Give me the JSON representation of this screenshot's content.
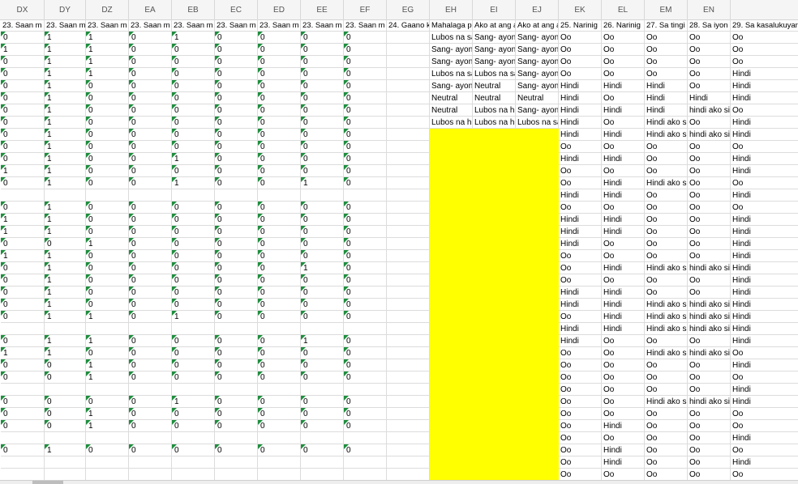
{
  "sheet": {
    "columns": [
      {
        "letter": "DX",
        "header": "23. Saan m"
      },
      {
        "letter": "DY",
        "header": "23. Saan m"
      },
      {
        "letter": "DZ",
        "header": "23. Saan m"
      },
      {
        "letter": "EA",
        "header": "23. Saan m"
      },
      {
        "letter": "EB",
        "header": "23. Saan m"
      },
      {
        "letter": "EC",
        "header": "23. Saan m"
      },
      {
        "letter": "ED",
        "header": "23. Saan m"
      },
      {
        "letter": "EE",
        "header": "23. Saan m"
      },
      {
        "letter": "EF",
        "header": "23. Saan m"
      },
      {
        "letter": "EG",
        "header": "24. Gaano k"
      },
      {
        "letter": "EH",
        "header": "Mahalaga p"
      },
      {
        "letter": "EI",
        "header": "Ako at ang a"
      },
      {
        "letter": "EJ",
        "header": "Ako at ang a"
      },
      {
        "letter": "EK",
        "header": "25. Narinig"
      },
      {
        "letter": "EL",
        "header": "26. Narinig"
      },
      {
        "letter": "EM",
        "header": "27. Sa tingi"
      },
      {
        "letter": "EN",
        "header": "28. Sa iyon"
      },
      {
        "letter": "",
        "header": "29. Sa kasalukuyan"
      }
    ],
    "rows": [
      [
        "0",
        "1",
        "1",
        "0",
        "1",
        "0",
        "0",
        "0",
        "0",
        "",
        "Lubos na sa",
        "Sang- ayon",
        "Sang- ayon",
        "Oo",
        "Oo",
        "Oo",
        "Oo",
        "Oo"
      ],
      [
        "1",
        "1",
        "1",
        "0",
        "0",
        "0",
        "0",
        "0",
        "0",
        "",
        "Sang- ayon",
        "Sang- ayon",
        "Sang- ayon",
        "Oo",
        "Oo",
        "Oo",
        "Oo",
        "Oo"
      ],
      [
        "0",
        "1",
        "1",
        "0",
        "0",
        "0",
        "0",
        "0",
        "0",
        "",
        "Sang- ayon",
        "Sang- ayon",
        "Sang- ayon",
        "Oo",
        "Oo",
        "Oo",
        "Oo",
        "Oo"
      ],
      [
        "0",
        "1",
        "1",
        "0",
        "0",
        "0",
        "0",
        "0",
        "0",
        "",
        "Lubos na sa",
        "Lubos na sa",
        "Sang- ayon",
        "Oo",
        "Oo",
        "Oo",
        "Oo",
        "Hindi"
      ],
      [
        "0",
        "1",
        "0",
        "0",
        "0",
        "0",
        "0",
        "0",
        "0",
        "",
        "Sang- ayon",
        "Neutral",
        "Sang- ayon",
        "Hindi",
        "Hindi",
        "Hindi",
        "Oo",
        "Hindi"
      ],
      [
        "0",
        "1",
        "0",
        "0",
        "0",
        "0",
        "0",
        "0",
        "0",
        "",
        "Neutral",
        "Neutral",
        "Neutral",
        "Hindi",
        "Oo",
        "Hindi",
        "Hindi",
        "Hindi"
      ],
      [
        "0",
        "1",
        "0",
        "0",
        "0",
        "0",
        "0",
        "0",
        "0",
        "",
        "Neutral",
        "Lubos na hi",
        "Sang- ayon",
        "Hindi",
        "Hindi",
        "Hindi",
        "hindi ako si",
        "Oo"
      ],
      [
        "0",
        "1",
        "0",
        "0",
        "0",
        "0",
        "0",
        "0",
        "0",
        "",
        "Lubos na hi",
        "Lubos na hi",
        "Lubos na sa",
        "Hindi",
        "Oo",
        "Hindi ako s",
        "Oo",
        "Hindi"
      ],
      [
        "0",
        "1",
        "0",
        "0",
        "0",
        "0",
        "0",
        "0",
        "0",
        "",
        "",
        "",
        "",
        "Hindi",
        "Hindi",
        "Hindi ako s",
        "hindi ako si",
        "Hindi"
      ],
      [
        "0",
        "1",
        "0",
        "0",
        "0",
        "0",
        "0",
        "0",
        "0",
        "",
        "",
        "",
        "",
        "Oo",
        "Oo",
        "Oo",
        "Oo",
        "Oo"
      ],
      [
        "0",
        "1",
        "0",
        "0",
        "1",
        "0",
        "0",
        "0",
        "0",
        "",
        "",
        "",
        "",
        "Hindi",
        "Hindi",
        "Oo",
        "Oo",
        "Hindi"
      ],
      [
        "1",
        "1",
        "0",
        "0",
        "0",
        "0",
        "0",
        "0",
        "0",
        "",
        "",
        "",
        "",
        "Oo",
        "Oo",
        "Oo",
        "Oo",
        "Hindi"
      ],
      [
        "0",
        "1",
        "0",
        "0",
        "1",
        "0",
        "0",
        "1",
        "0",
        "",
        "",
        "",
        "",
        "Oo",
        "Hindi",
        "Hindi ako s",
        "Oo",
        "Oo"
      ],
      [
        "",
        "",
        "",
        "",
        "",
        "",
        "",
        "",
        "",
        "",
        "",
        "",
        "",
        "Hindi",
        "Hindi",
        "Oo",
        "Oo",
        "Hindi"
      ],
      [
        "0",
        "1",
        "0",
        "0",
        "0",
        "0",
        "0",
        "0",
        "0",
        "",
        "",
        "",
        "",
        "Oo",
        "Oo",
        "Oo",
        "Oo",
        "Oo"
      ],
      [
        "1",
        "1",
        "0",
        "0",
        "0",
        "0",
        "0",
        "0",
        "0",
        "",
        "",
        "",
        "",
        "Hindi",
        "Hindi",
        "Oo",
        "Oo",
        "Hindi"
      ],
      [
        "1",
        "1",
        "0",
        "0",
        "0",
        "0",
        "0",
        "0",
        "0",
        "",
        "",
        "",
        "",
        "Hindi",
        "Hindi",
        "Oo",
        "Oo",
        "Hindi"
      ],
      [
        "0",
        "0",
        "1",
        "0",
        "0",
        "0",
        "0",
        "0",
        "0",
        "",
        "",
        "",
        "",
        "Hindi",
        "Oo",
        "Oo",
        "Oo",
        "Hindi"
      ],
      [
        "1",
        "1",
        "0",
        "0",
        "0",
        "0",
        "0",
        "0",
        "0",
        "",
        "",
        "",
        "",
        "Oo",
        "Oo",
        "Oo",
        "Oo",
        "Hindi"
      ],
      [
        "0",
        "1",
        "0",
        "0",
        "0",
        "0",
        "0",
        "1",
        "0",
        "",
        "",
        "",
        "",
        "Oo",
        "Hindi",
        "Hindi ako s",
        "hindi ako si",
        "Hindi"
      ],
      [
        "0",
        "1",
        "0",
        "0",
        "0",
        "0",
        "0",
        "0",
        "0",
        "",
        "",
        "",
        "",
        "Oo",
        "Oo",
        "Oo",
        "Oo",
        "Hindi"
      ],
      [
        "0",
        "1",
        "0",
        "0",
        "0",
        "0",
        "0",
        "0",
        "0",
        "",
        "",
        "",
        "",
        "Hindi",
        "Hindi",
        "Oo",
        "Oo",
        "Hindi"
      ],
      [
        "0",
        "1",
        "0",
        "0",
        "0",
        "0",
        "0",
        "0",
        "0",
        "",
        "",
        "",
        "",
        "Hindi",
        "Hindi",
        "Hindi ako s",
        "hindi ako si",
        "Hindi"
      ],
      [
        "0",
        "1",
        "1",
        "0",
        "1",
        "0",
        "0",
        "0",
        "0",
        "",
        "",
        "",
        "",
        "Oo",
        "Hindi",
        "Hindi ako s",
        "hindi ako si",
        "Hindi"
      ],
      [
        "",
        "",
        "",
        "",
        "",
        "",
        "",
        "",
        "",
        "",
        "",
        "",
        "",
        "Hindi",
        "Hindi",
        "Hindi ako s",
        "hindi ako si",
        "Hindi"
      ],
      [
        "0",
        "1",
        "1",
        "0",
        "0",
        "0",
        "0",
        "1",
        "0",
        "",
        "",
        "",
        "",
        "Hindi",
        "Oo",
        "Oo",
        "Oo",
        "Hindi"
      ],
      [
        "1",
        "1",
        "0",
        "0",
        "0",
        "0",
        "0",
        "0",
        "0",
        "",
        "",
        "",
        "",
        "Oo",
        "Oo",
        "Hindi ako s",
        "hindi ako si",
        "Oo"
      ],
      [
        "0",
        "0",
        "1",
        "0",
        "0",
        "0",
        "0",
        "0",
        "0",
        "",
        "",
        "",
        "",
        "Oo",
        "Oo",
        "Oo",
        "Oo",
        "Hindi"
      ],
      [
        "0",
        "0",
        "1",
        "0",
        "0",
        "0",
        "0",
        "0",
        "0",
        "",
        "",
        "",
        "",
        "Oo",
        "Oo",
        "Oo",
        "Oo",
        "Oo"
      ],
      [
        "",
        "",
        "",
        "",
        "",
        "",
        "",
        "",
        "",
        "",
        "",
        "",
        "",
        "Oo",
        "Oo",
        "Oo",
        "Oo",
        "Hindi"
      ],
      [
        "0",
        "0",
        "0",
        "0",
        "1",
        "0",
        "0",
        "0",
        "0",
        "",
        "",
        "",
        "",
        "Oo",
        "Oo",
        "Hindi ako s",
        "hindi ako si",
        "Hindi"
      ],
      [
        "0",
        "0",
        "1",
        "0",
        "0",
        "0",
        "0",
        "0",
        "0",
        "",
        "",
        "",
        "",
        "Oo",
        "Oo",
        "Oo",
        "Oo",
        "Oo"
      ],
      [
        "0",
        "0",
        "1",
        "0",
        "0",
        "0",
        "0",
        "0",
        "0",
        "",
        "",
        "",
        "",
        "Oo",
        "Hindi",
        "Oo",
        "Oo",
        "Oo"
      ],
      [
        "",
        "",
        "",
        "",
        "",
        "",
        "",
        "",
        "",
        "",
        "",
        "",
        "",
        "Oo",
        "Oo",
        "Oo",
        "Oo",
        "Hindi"
      ],
      [
        "0",
        "1",
        "0",
        "0",
        "0",
        "0",
        "0",
        "0",
        "0",
        "",
        "",
        "",
        "",
        "Oo",
        "Hindi",
        "Oo",
        "Oo",
        "Oo"
      ],
      [
        "",
        "",
        "",
        "",
        "",
        "",
        "",
        "",
        "",
        "",
        "",
        "",
        "",
        "Oo",
        "Hindi",
        "Oo",
        "Oo",
        "Hindi"
      ],
      [
        "",
        "",
        "",
        "",
        "",
        "",
        "",
        "",
        "",
        "",
        "",
        "",
        "",
        "Oo",
        "Oo",
        "Oo",
        "Oo",
        "Oo"
      ]
    ],
    "highlight_color": "#ffff00",
    "number_marker_color": "#1e8e3e"
  }
}
